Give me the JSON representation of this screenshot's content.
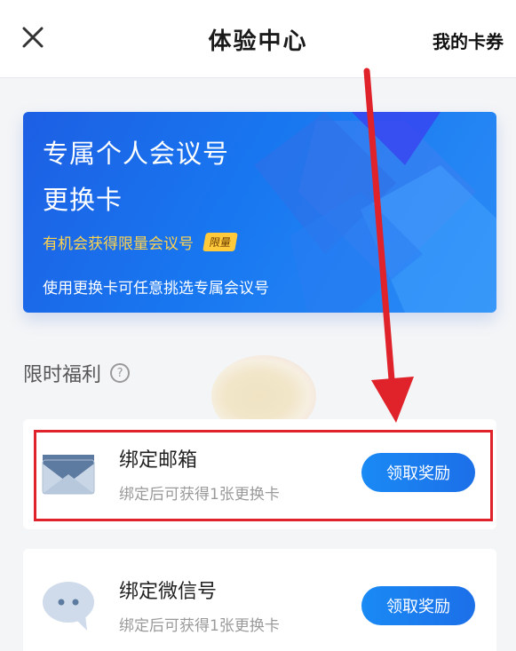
{
  "header": {
    "title": "体验中心",
    "right_link": "我的卡券"
  },
  "banner": {
    "title_line1": "专属个人会议号",
    "title_line2": "更换卡",
    "subtitle": "有机会获得限量会议号",
    "badge": "限量",
    "description": "使用更换卡可任意挑选专属会议号"
  },
  "section": {
    "title": "限时福利",
    "help_glyph": "?"
  },
  "tasks": [
    {
      "title": "绑定邮箱",
      "description": "绑定后可获得1张更换卡",
      "button": "领取奖励",
      "icon": "envelope-icon"
    },
    {
      "title": "绑定微信号",
      "description": "绑定后可获得1张更换卡",
      "button": "领取奖励",
      "icon": "chat-bubble-icon"
    }
  ],
  "colors": {
    "accent": "#1c7bf0",
    "annotation_red": "#e0222a",
    "banner_highlight": "#ffd34e"
  }
}
